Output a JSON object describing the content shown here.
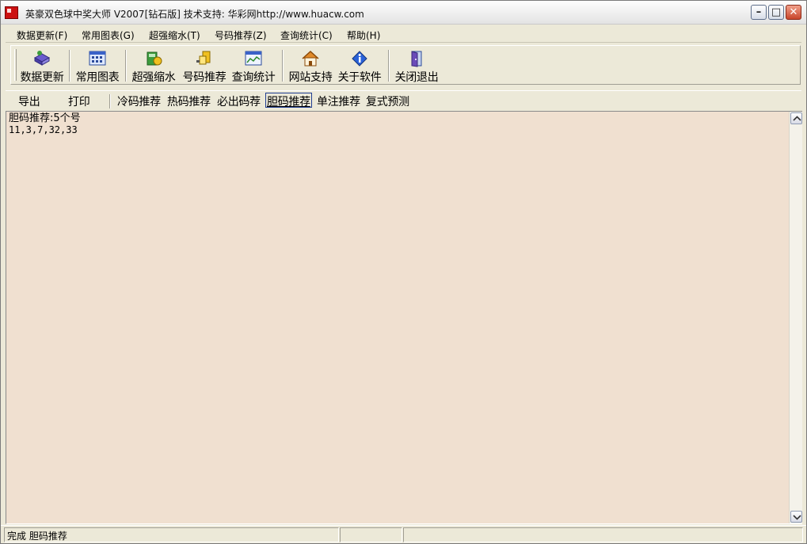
{
  "window": {
    "title": "英豪双色球中奖大师   V2007[钻石版]  技术支持: 华彩网http://www.huacw.com",
    "controls": {
      "minimize": "–",
      "maximize": "□",
      "close": "✕"
    }
  },
  "menu": {
    "items": [
      {
        "label": "数据更新(F)"
      },
      {
        "label": "常用图表(G)"
      },
      {
        "label": "超强缩水(T)"
      },
      {
        "label": "号码推荐(Z)"
      },
      {
        "label": "查询统计(C)"
      },
      {
        "label": "帮助(H)"
      }
    ]
  },
  "toolbar": {
    "buttons": [
      {
        "label": "数据更新",
        "icon": "data-update-icon"
      },
      {
        "label": "常用图表",
        "icon": "chart-icon"
      },
      {
        "label": "超强缩水",
        "icon": "filter-icon"
      },
      {
        "label": "号码推荐",
        "icon": "recommend-icon"
      },
      {
        "label": "查询统计",
        "icon": "stats-icon"
      },
      {
        "label": "网站支持",
        "icon": "home-icon"
      },
      {
        "label": "关于软件",
        "icon": "info-icon"
      },
      {
        "label": "关闭退出",
        "icon": "exit-door-icon"
      }
    ]
  },
  "tabs": {
    "actions": [
      {
        "label": "导出"
      },
      {
        "label": "打印"
      }
    ],
    "items": [
      {
        "label": "冷码推荐"
      },
      {
        "label": "热码推荐"
      },
      {
        "label": "必出码荐"
      },
      {
        "label": "胆码推荐",
        "active": true
      },
      {
        "label": "单注推荐"
      },
      {
        "label": "复式预测"
      }
    ]
  },
  "content": {
    "heading": "胆码推荐:5个号",
    "numbers": "11,3,7,32,33"
  },
  "status": {
    "text": "完成 胆码推荐"
  }
}
